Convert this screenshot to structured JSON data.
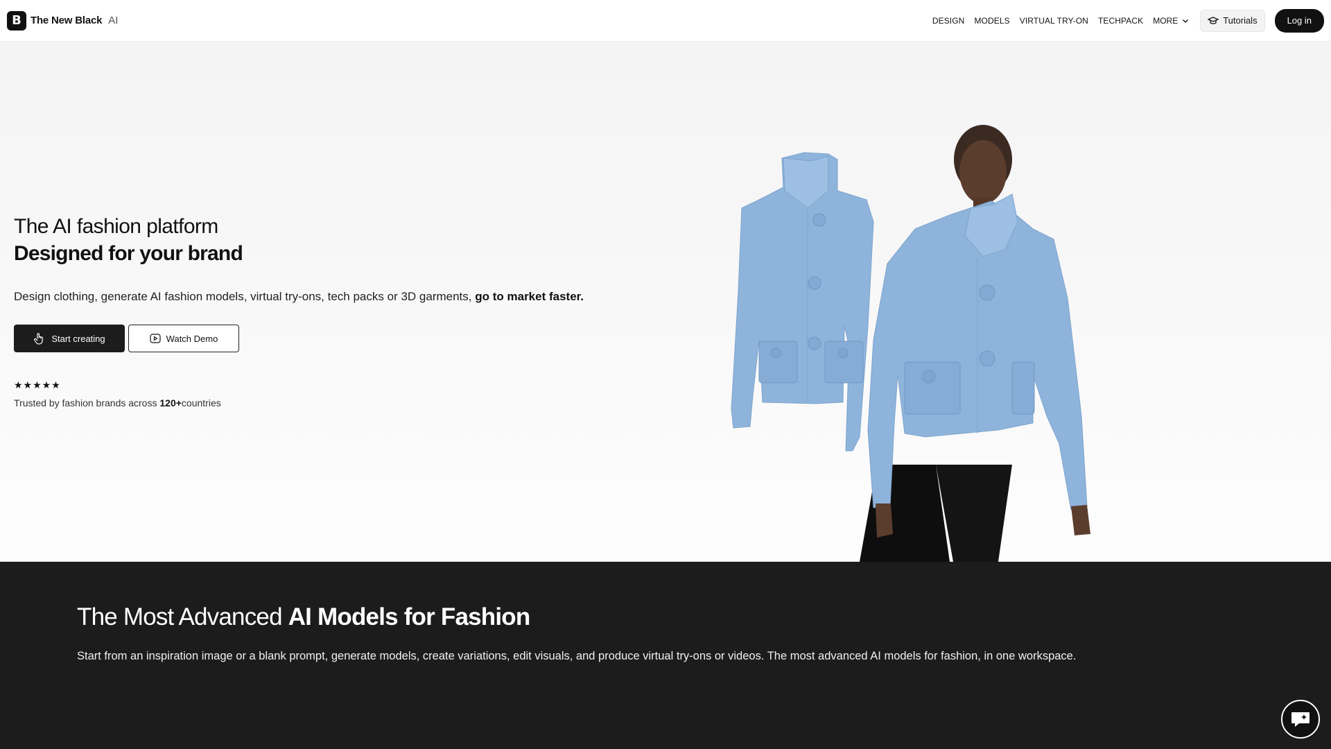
{
  "brand": {
    "name": "The New Black",
    "suffix": "AI",
    "logo_letter": "B"
  },
  "nav": {
    "items": [
      "DESIGN",
      "MODELS",
      "VIRTUAL TRY-ON",
      "TECHPACK"
    ],
    "more_label": "MORE",
    "tutorials_label": "Tutorials",
    "login_label": "Log in"
  },
  "hero": {
    "title_line1": "The AI fashion platform",
    "title_line2": "Designed for your brand",
    "subtitle": "Design clothing, generate AI fashion models, virtual try-ons, tech packs or 3D garments,",
    "subtitle_bold": "go to market faster.",
    "cta_primary": "Start creating",
    "cta_secondary": "Watch Demo",
    "stars": "★★★★★",
    "rating_value": 5,
    "trust_prefix": "Trusted by fashion brands across",
    "trust_count": "120+",
    "trust_suffix": "countries"
  },
  "section": {
    "title_light": "The Most Advanced",
    "title_bold": "AI Models for Fashion",
    "description": "Start from an inspiration image or a blank prompt, generate models, create variations, edit visuals, and produce virtual try-ons or videos. The most advanced AI models for fashion, in one workspace."
  },
  "colors": {
    "dark_bg": "#1c1c1d",
    "jacket": "#8fb4dc",
    "accent": "#111111"
  },
  "icons": [
    "pointer-hand-icon",
    "play-icon",
    "graduation-cap-icon",
    "chevron-down-icon",
    "chat-icon"
  ]
}
